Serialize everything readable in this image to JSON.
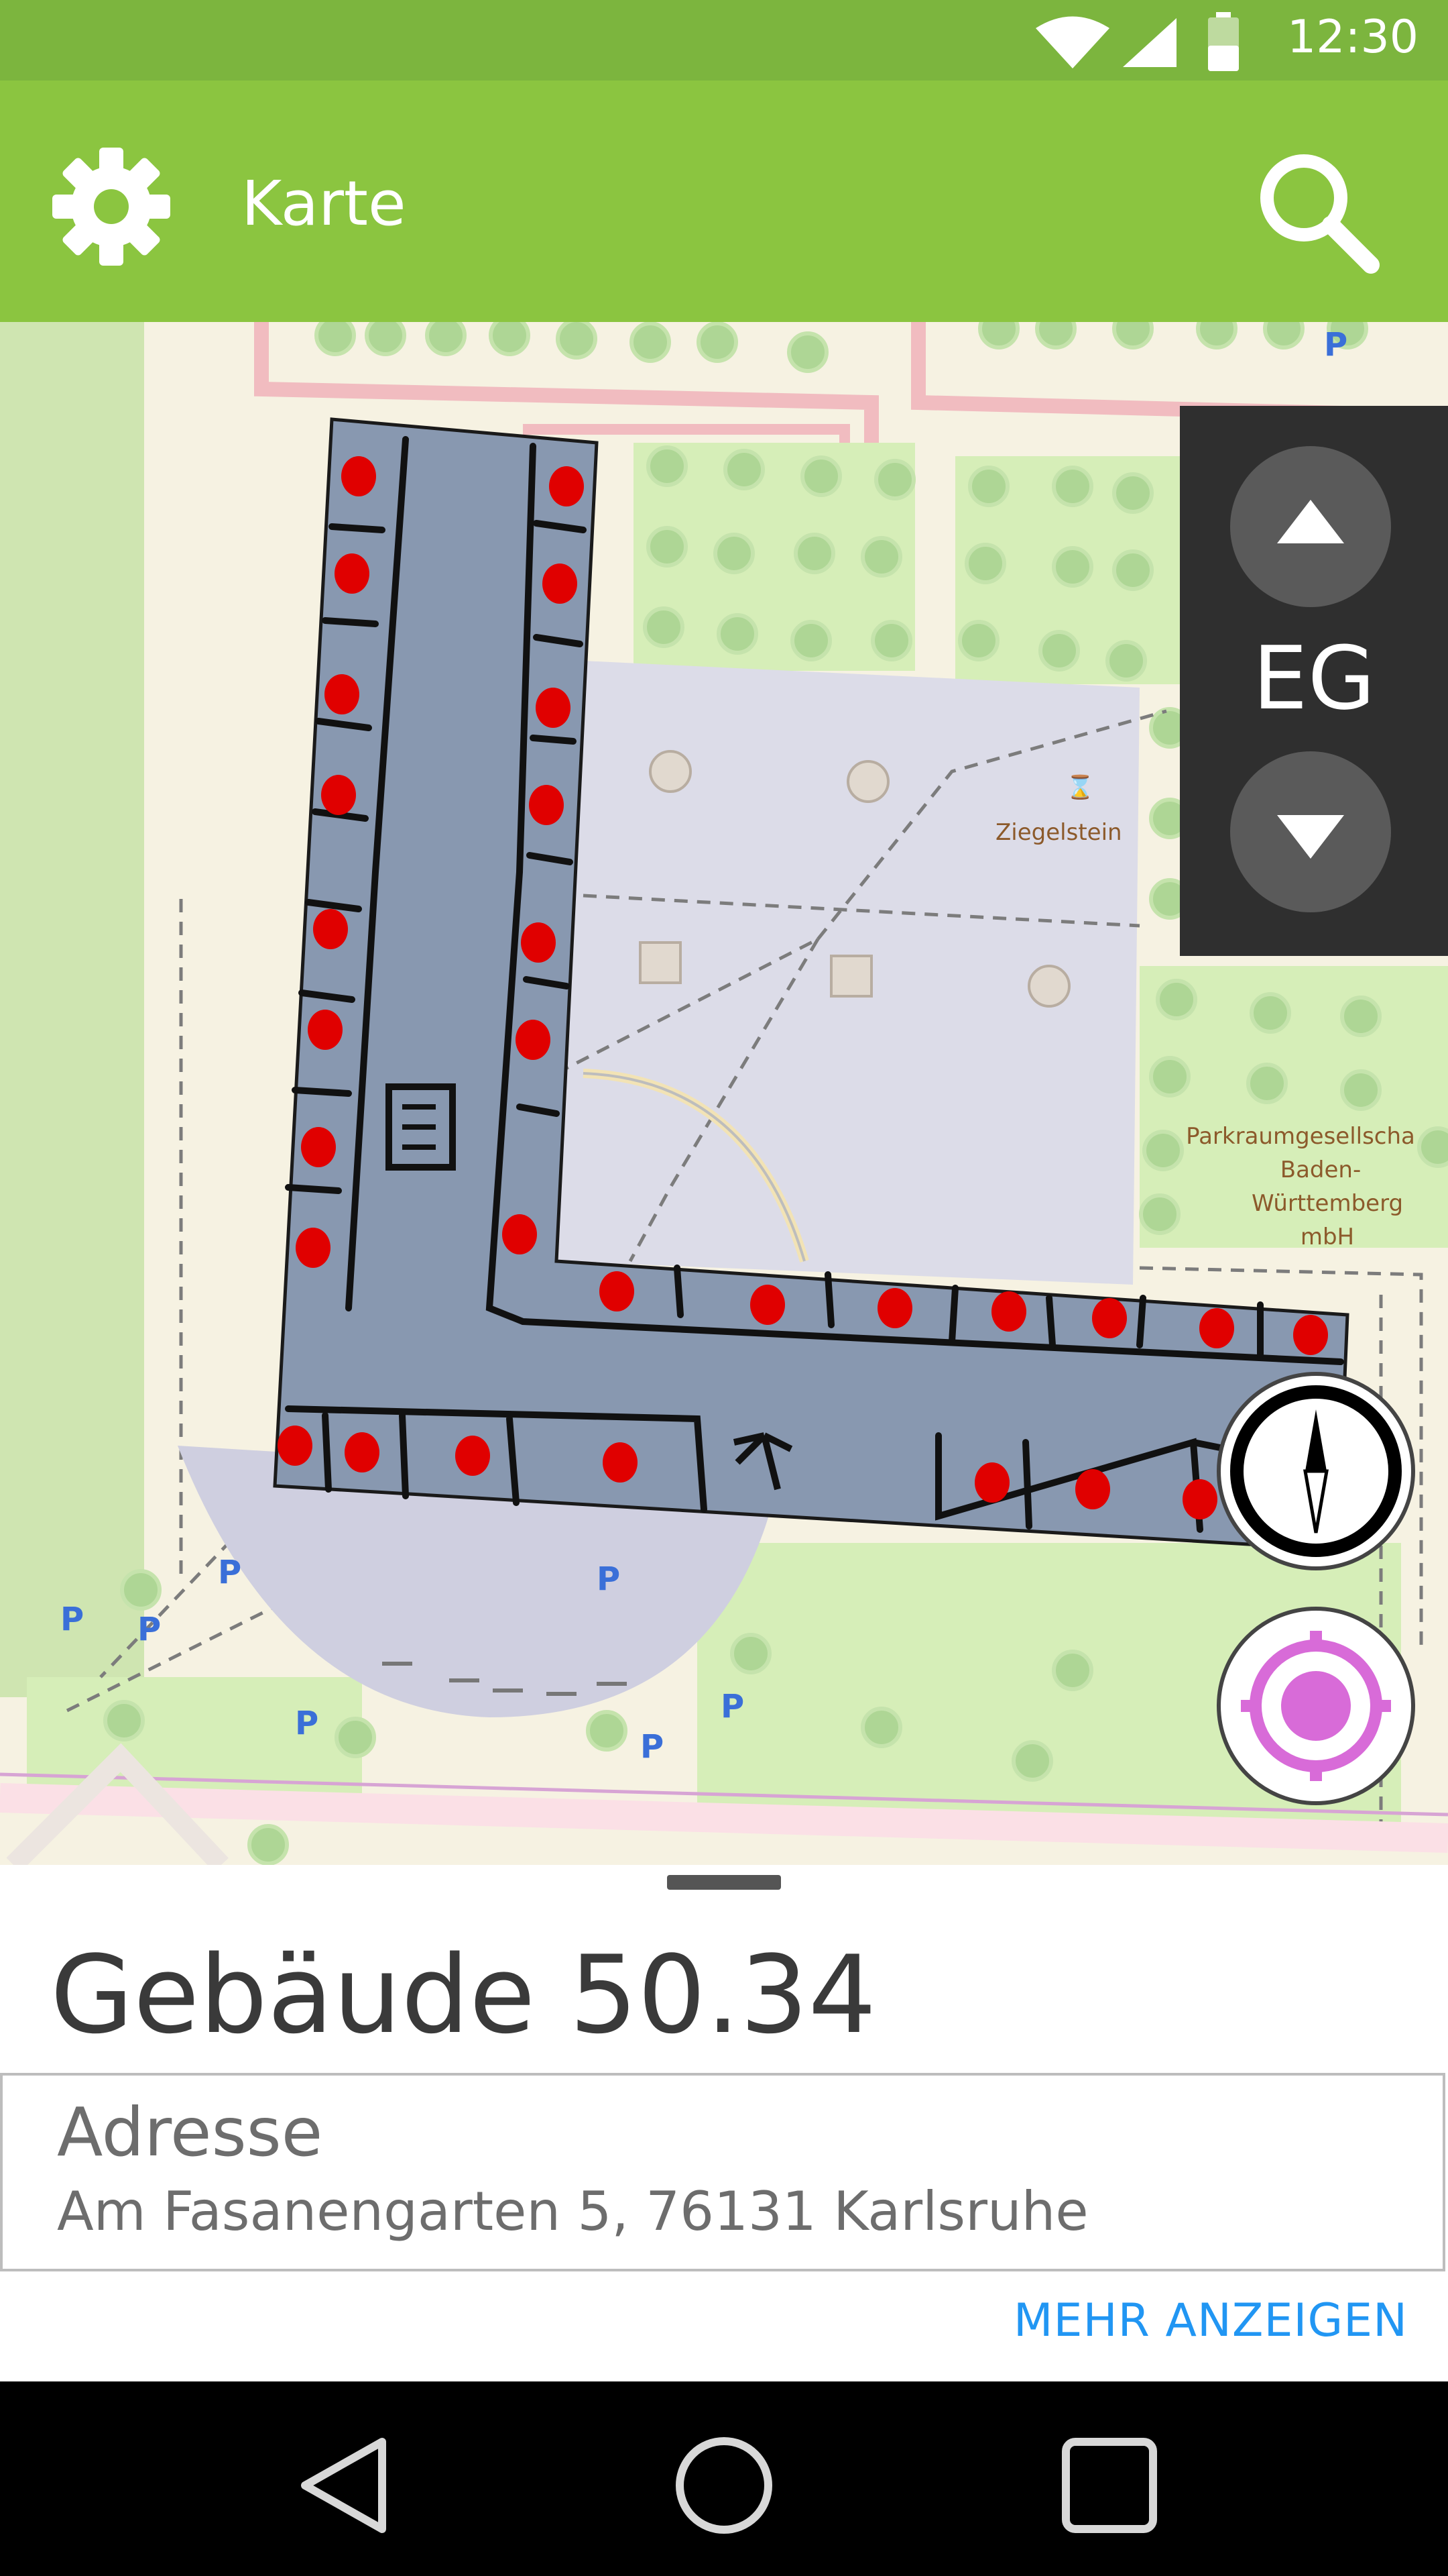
{
  "status_bar": {
    "time": "12:30",
    "icons": [
      "wifi-icon",
      "signal-icon",
      "battery-icon"
    ]
  },
  "app_bar": {
    "title": "Karte",
    "left_icon": "gear-icon",
    "right_icon": "search-icon"
  },
  "map": {
    "labels": {
      "poi_1": "Ziegelstein",
      "poi_2_line1": "Parkraumgesellscha",
      "poi_2_line2": "Baden-",
      "poi_2_line3": "Württemberg",
      "poi_2_line4": "mbH",
      "parking": "P"
    },
    "floor_selector": {
      "level": "EG"
    }
  },
  "bottom_sheet": {
    "title": "Gebäude 50.34",
    "address_label": "Adresse",
    "address_value": "Am Fasanengarten 5, 76131 Karlsruhe",
    "more_link": "MEHR ANZEIGEN"
  },
  "colors": {
    "status_bar": "#7cb53e",
    "app_bar": "#8bc540",
    "building_fill": "#8898b0",
    "marker": "#e00000",
    "location_accent": "#d86bd8",
    "link": "#2196f3"
  }
}
